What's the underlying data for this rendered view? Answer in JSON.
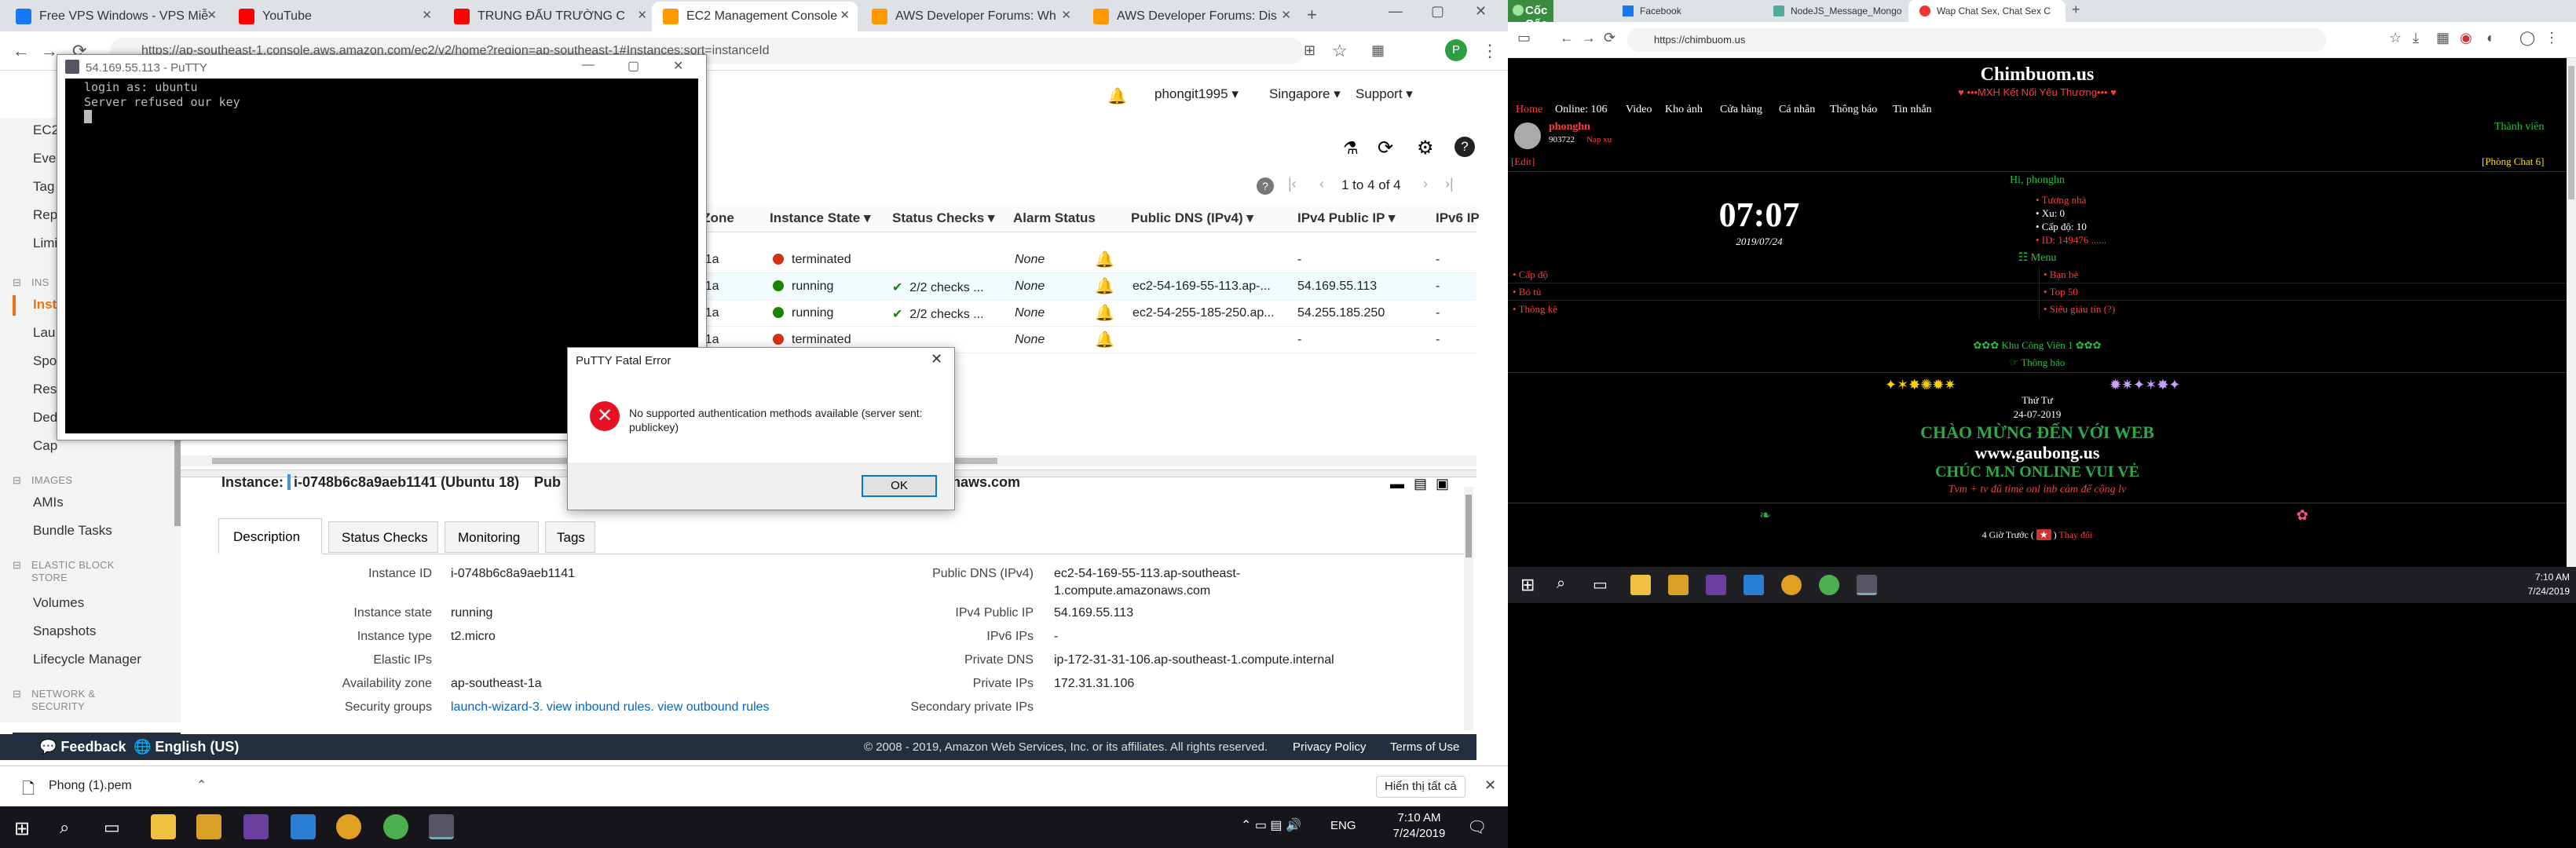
{
  "left_browser": {
    "tabs": [
      {
        "title": "Free VPS Windows - VPS Miễ",
        "favicon_color": "#1877f2",
        "icon": "facebook-icon"
      },
      {
        "title": "YouTube",
        "favicon_color": "#ff0000",
        "icon": "youtube-icon"
      },
      {
        "title": "TRUNG ĐẤU TRƯỜNG C",
        "favicon_color": "#ff0000",
        "icon": "youtube-icon"
      },
      {
        "title": "EC2 Management Console",
        "favicon_color": "#ff9900",
        "icon": "aws-icon"
      },
      {
        "title": "AWS Developer Forums: Wh",
        "favicon_color": "#ff9900",
        "icon": "aws-icon"
      },
      {
        "title": "AWS Developer Forums: Dis",
        "favicon_color": "#ff9900",
        "icon": "aws-icon"
      }
    ],
    "url": "https://ap-southeast-1.console.aws.amazon.com/ec2/v2/home?region=ap-southeast-1#Instances:sort=instanceId",
    "profile_letter": "P"
  },
  "aws": {
    "user": "phongit1995",
    "region": "Singapore",
    "support": "Support",
    "pagination": "1 to 4 of 4",
    "left_nav_partial": [
      "EC2",
      "Eve",
      "Tag",
      "Rep",
      "Limi"
    ],
    "instances_section": "INS",
    "instances_nav": [
      "Inst",
      "Lau",
      "Spo",
      "Res",
      "Ded",
      "Cap"
    ],
    "images_section": "IMAGES",
    "images_items": [
      "AMIs",
      "Bundle Tasks"
    ],
    "ebs_section": "ELASTIC BLOCK STORE",
    "ebs_items": [
      "Volumes",
      "Snapshots",
      "Lifecycle Manager"
    ],
    "net_section": "NETWORK & SECURITY",
    "columns": [
      "y Zone",
      "Instance State",
      "Status Checks",
      "Alarm Status",
      "Public DNS (IPv4)",
      "IPv4 Public IP",
      "IPv6 IP"
    ],
    "rows": [
      {
        "zone": "st-1a",
        "state": "terminated",
        "state_color": "#d13212",
        "checks": "",
        "alarm": "None",
        "dns": "",
        "ip": "-",
        "ipv6": "-"
      },
      {
        "zone": "st-1a",
        "state": "running",
        "state_color": "#1d8102",
        "checks": "2/2 checks ...",
        "alarm": "None",
        "dns": "ec2-54-169-55-113.ap-...",
        "ip": "54.169.55.113",
        "ipv6": "-"
      },
      {
        "zone": "st-1a",
        "state": "running",
        "state_color": "#1d8102",
        "checks": "2/2 checks ...",
        "alarm": "None",
        "dns": "ec2-54-255-185-250.ap...",
        "ip": "54.255.185.250",
        "ipv6": "-"
      },
      {
        "zone": "st-1a",
        "state": "terminated",
        "state_color": "#d13212",
        "checks": "",
        "alarm": "None",
        "dns": "",
        "ip": "-",
        "ipv6": "-"
      }
    ],
    "instance_label": "Instance:",
    "instance_id_title": "i-0748b6c8a9aeb1141 (Ubuntu 18)",
    "instance_pub_partial": "Pub",
    "instance_dns_tail": "naws.com",
    "detail_tabs": [
      "Description",
      "Status Checks",
      "Monitoring",
      "Tags"
    ],
    "details_left": [
      {
        "label": "Instance ID",
        "value": "i-0748b6c8a9aeb1141"
      },
      {
        "label": "Instance state",
        "value": "running"
      },
      {
        "label": "Instance type",
        "value": "t2.micro"
      },
      {
        "label": "Elastic IPs",
        "value": ""
      },
      {
        "label": "Availability zone",
        "value": "ap-southeast-1a"
      },
      {
        "label": "Security groups",
        "value": "launch-wizard-3. view inbound rules. view outbound rules"
      }
    ],
    "details_right": [
      {
        "label": "Public DNS (IPv4)",
        "value": "ec2-54-169-55-113.ap-southeast-",
        "value2": "1.compute.amazonaws.com"
      },
      {
        "label": "IPv4 Public IP",
        "value": "54.169.55.113"
      },
      {
        "label": "IPv6 IPs",
        "value": "-"
      },
      {
        "label": "Private DNS",
        "value": "ip-172-31-31-106.ap-southeast-1.compute.internal"
      },
      {
        "label": "Private IPs",
        "value": "172.31.31.106"
      },
      {
        "label": "Secondary private IPs",
        "value": ""
      }
    ],
    "footer": {
      "feedback": "Feedback",
      "language": "English (US)",
      "copyright": "© 2008 - 2019, Amazon Web Services, Inc. or its affiliates. All rights reserved.",
      "privacy": "Privacy Policy",
      "terms": "Terms of Use"
    }
  },
  "download_bar": {
    "file": "Phong (1).pem",
    "show_all": "Hiển thị tất cả"
  },
  "left_taskbar": {
    "clock_time": "7:10 AM",
    "clock_date": "7/24/2019",
    "lang": "ENG"
  },
  "putty": {
    "title": "54.169.55.113 - PuTTY",
    "lines": [
      "login as: ubuntu",
      "Server refused our key"
    ]
  },
  "putty_error": {
    "title": "PuTTY Fatal Error",
    "message": "No supported authentication methods available (server sent: publickey)",
    "ok": "OK"
  },
  "right_browser": {
    "brand": "Cốc Cốc",
    "tabs": [
      "Facebook",
      "NodeJS_Message_Mongo",
      "Wap Chat Sex, Chat Sex C"
    ],
    "url": "https://chimbuom.us"
  },
  "site": {
    "logo": "Chimbuom.us",
    "slogan": "•••MXH Kết Nối Yêu Thương•••",
    "nav": [
      "Home",
      "Online: 106",
      "Video",
      "Kho ảnh",
      "Cửa hàng",
      "Cá nhân",
      "Thông báo",
      "Tin nhắn"
    ],
    "username": "phonghn",
    "user_xu": "903722",
    "user_role": "Nạp xu",
    "member_link": "Thành viên",
    "edit": "[Edit]",
    "chat_room": "[Phòng Chat 6]",
    "greeting": "Hi, phonghn",
    "clock": "07:07",
    "date": "2019/07/24",
    "stats": [
      "• Tương nhà",
      "• Xu: 0",
      "• Cấp độ: 10",
      "• ID: 149476 ......"
    ],
    "menu_title": "☷ Menu",
    "menu_left": [
      "• Cấp độ",
      "• Bỏ tủ",
      "• Thông kê"
    ],
    "menu_right": [
      "• Bạn bè",
      "• Top 50",
      "• Siêu giáu tín (?)"
    ],
    "park": "✿✿✿ Khu Công Viên 1 ✿✿✿",
    "notice": "☞ Thông báo",
    "stars_left": "✦✶✸✺✹✷",
    "stars_right": "✹✷✦✶✸✦",
    "weekday": "Thứ Tư",
    "date_banner": "24-07-2019",
    "welcome": "CHÀO MỪNG ĐẾN VỚI WEB",
    "domain": "www.gaubong.us",
    "wish": "CHÚC M.N ONLINE VUI VẺ",
    "tagline": "Tvm + tv đũ time onl inb cảm để cộng lv",
    "ago": "4 Giờ Trước",
    "change": "Thay đổi"
  },
  "right_taskbar": {
    "clock_time": "7:10 AM",
    "clock_date": "7/24/2019"
  }
}
